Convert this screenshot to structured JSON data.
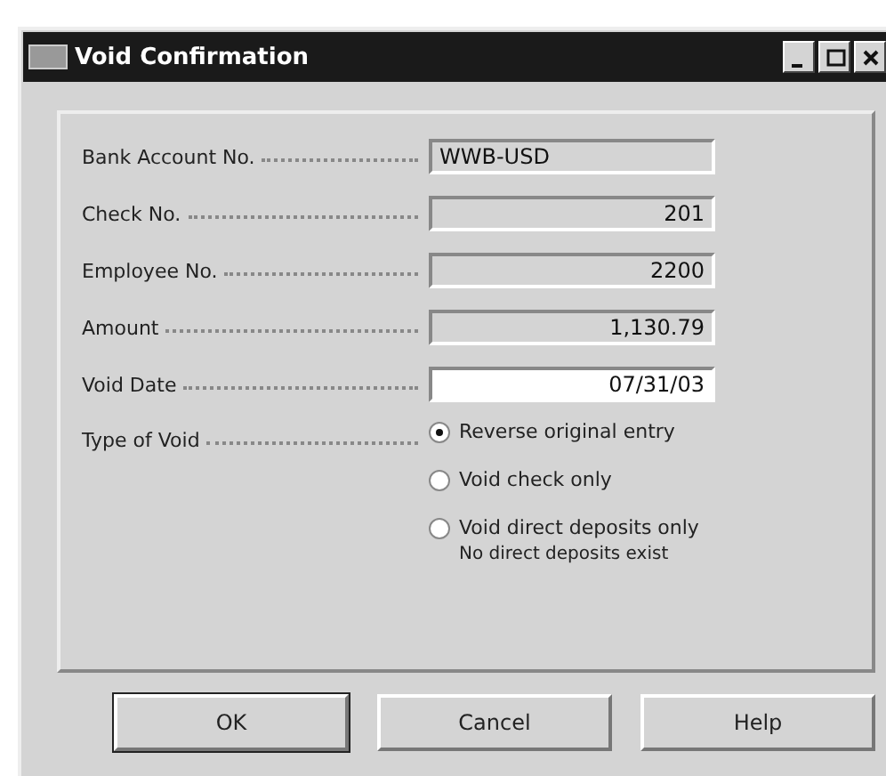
{
  "window": {
    "title": "Void Confirmation"
  },
  "fields": [
    {
      "label": "Bank Account No.",
      "value": "WWB-USD",
      "kind": "text",
      "editable": false
    },
    {
      "label": "Check No.",
      "value": "201",
      "kind": "number",
      "editable": false
    },
    {
      "label": "Employee No.",
      "value": "2200",
      "kind": "number",
      "editable": false
    },
    {
      "label": "Amount",
      "value": "1,130.79",
      "kind": "number",
      "editable": false
    },
    {
      "label": "Void Date",
      "value": "07/31/03",
      "kind": "number",
      "editable": true
    }
  ],
  "type_of_void": {
    "label": "Type of Void",
    "options": [
      {
        "label": "Reverse original entry",
        "selected": true
      },
      {
        "label": "Void check only",
        "selected": false
      },
      {
        "label": "Void direct deposits only",
        "selected": false,
        "note": "No direct deposits exist"
      }
    ]
  },
  "buttons": [
    {
      "label": "OK",
      "default": true
    },
    {
      "label": "Cancel",
      "default": false
    },
    {
      "label": "Help",
      "default": false
    }
  ]
}
